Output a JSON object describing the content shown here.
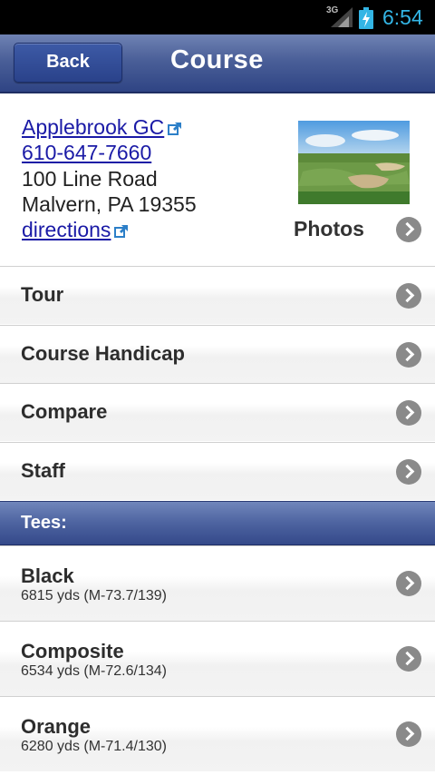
{
  "status_bar": {
    "network": "3G",
    "time": "6:54",
    "time_color": "#33b5e5"
  },
  "header": {
    "back_label": "Back",
    "title": "Course"
  },
  "course": {
    "name": "Applebrook GC",
    "phone": "610-647-7660",
    "address_line1": "100 Line Road",
    "address_line2": "Malvern, PA 19355",
    "directions_label": "directions",
    "photos_label": "Photos",
    "link_color": "#1a1aa6"
  },
  "menu": [
    {
      "label": "Tour"
    },
    {
      "label": "Course Handicap"
    },
    {
      "label": "Compare"
    },
    {
      "label": "Staff"
    }
  ],
  "tees_section": {
    "label": "Tees:"
  },
  "tees": [
    {
      "name": "Black",
      "detail": "6815 yds (M-73.7/139)"
    },
    {
      "name": "Composite",
      "detail": "6534 yds (M-72.6/134)"
    },
    {
      "name": "Orange",
      "detail": "6280 yds (M-71.4/130)"
    }
  ],
  "colors": {
    "header_blue": "#4a5f98",
    "chevron_gray": "#8a8a8a"
  }
}
